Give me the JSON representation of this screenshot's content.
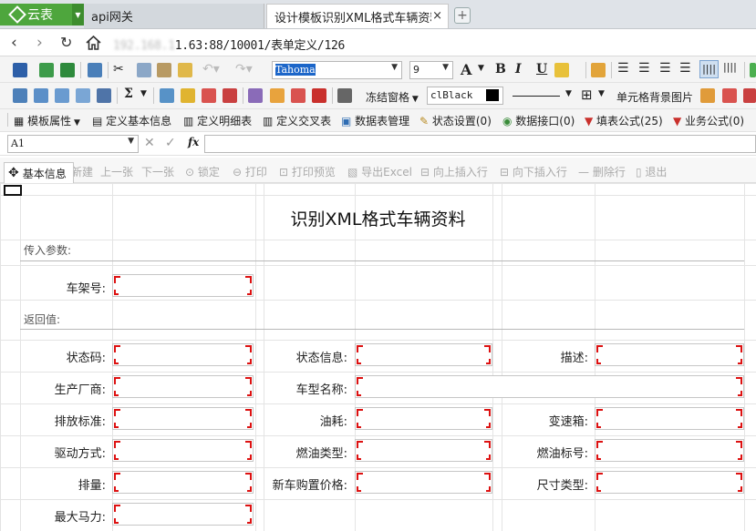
{
  "browser": {
    "app_name": "云表",
    "tabs": [
      {
        "label": "api网关"
      },
      {
        "label": "设计模板识别XML格式车辆资料"
      }
    ],
    "close_glyph": "×",
    "new_tab_glyph": "+",
    "address": {
      "prefix_hidden": "192.168.1",
      "visible": "1.63:88/10001/表单定义/126"
    }
  },
  "toolbar1": {
    "font_name": "Tahoma",
    "font_size": "9"
  },
  "toolbar2": {
    "sum_glyph": "Σ",
    "freeze_label": "冻结窗格",
    "color_name": "clBlack",
    "cell_bg_label": "单元格背景图片"
  },
  "toolbar3": {
    "items": [
      {
        "label": "模板属性",
        "icon": "template-icon"
      },
      {
        "label": "定义基本信息",
        "icon": "basic-info-icon"
      },
      {
        "label": "定义明细表",
        "icon": "detail-table-icon"
      },
      {
        "label": "定义交叉表",
        "icon": "cross-table-icon"
      },
      {
        "label": "数据表管理",
        "icon": "data-table-icon"
      },
      {
        "label": "状态设置(0)",
        "icon": "status-icon"
      },
      {
        "label": "数据接口(0)",
        "icon": "data-interface-icon"
      },
      {
        "label": "填表公式(25)",
        "icon": "fill-formula-icon"
      },
      {
        "label": "业务公式(0)",
        "icon": "business-formula-icon"
      }
    ]
  },
  "formula_bar": {
    "cell_ref": "A1",
    "fx": "fx",
    "cancel": "✕",
    "confirm": "✓"
  },
  "form_toolbar": {
    "basic_tab": "基本信息",
    "items": [
      "新建",
      "上一张",
      "下一张",
      "锁定",
      "打印",
      "打印预览",
      "导出Excel",
      "向上插入行",
      "向下插入行",
      "删除行",
      "退出"
    ]
  },
  "form": {
    "title": "识别XML格式车辆资料",
    "section_input": "传入参数:",
    "section_return": "返回值:",
    "labels": {
      "vin": "车架号:",
      "status_code": "状态码:",
      "status_info": "状态信息:",
      "desc": "描述:",
      "maker": "生产厂商:",
      "model_name": "车型名称:",
      "emission": "排放标准:",
      "fuel_use": "油耗:",
      "gearbox": "变速箱:",
      "drive": "驱动方式:",
      "fuel_type": "燃油类型:",
      "fuel_grade": "燃油标号:",
      "displacement": "排量:",
      "new_price": "新车购置价格:",
      "size_type": "尺寸类型:",
      "max_power": "最大马力:"
    }
  }
}
